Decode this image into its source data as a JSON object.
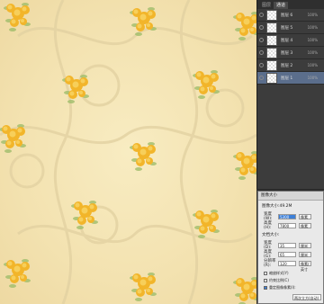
{
  "layers_panel": {
    "tabs": [
      "图层",
      "通道"
    ],
    "active_tab": 1,
    "layers": [
      {
        "name": "图层 6",
        "opacity": "100%"
      },
      {
        "name": "图层 5",
        "opacity": "100%"
      },
      {
        "name": "图层 4",
        "opacity": "100%"
      },
      {
        "name": "图层 3",
        "opacity": "100%"
      },
      {
        "name": "图层 2",
        "opacity": "100%"
      },
      {
        "name": "图层 1",
        "opacity": "100%"
      }
    ]
  },
  "dialog": {
    "title": "图像大小",
    "size_label": "图像大小:49.2M",
    "width_label": "宽度(W):",
    "width_value": "5300",
    "width_unit": "像素",
    "height_label": "高度(H):",
    "height_value": "7800",
    "height_unit": "像素",
    "doc_size_label": "文档大小:",
    "doc_width_label": "宽度(D):",
    "doc_width_value": "35",
    "doc_width_unit": "厘米",
    "doc_height_label": "高度(G):",
    "doc_height_value": "65",
    "doc_height_unit": "厘米",
    "resolution_label": "分辨率(R):",
    "resolution_value": "120",
    "resolution_unit": "像素/英寸",
    "scale_styles": "缩放样式(Y)",
    "constrain": "约束比例(C)",
    "resample": "重定图像像素(I):",
    "resample_method": "两次立方(自动)"
  },
  "colors": {
    "paper": "#f3e2b0",
    "scroll": "#e3d2a2",
    "petal": "#f2b52a",
    "petal_light": "#f7cf5a",
    "leaf": "#9fbd6a"
  }
}
